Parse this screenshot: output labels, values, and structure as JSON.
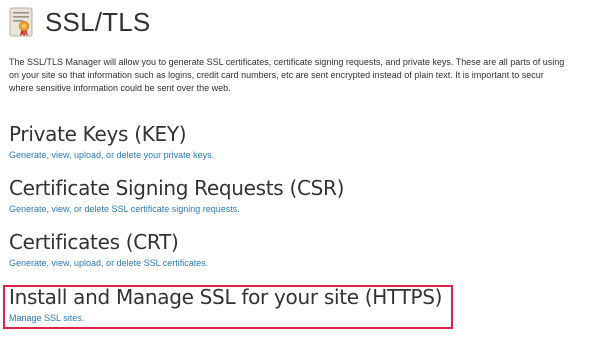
{
  "header": {
    "title": "SSL/TLS",
    "icon": "certificate-icon"
  },
  "intro": {
    "line1": "The SSL/TLS Manager will allow you to generate SSL certificates, certificate signing requests, and private keys. These are all parts of using",
    "line2": "on your site so that information such as logins, credit card numbers, etc are sent encrypted instead of plain text. It is important to secur",
    "line3": "where sensitive information could be sent over the web."
  },
  "sections": [
    {
      "title": "Private Keys (KEY)",
      "link": "Generate, view, upload, or delete your private keys."
    },
    {
      "title": "Certificate Signing Requests (CSR)",
      "link": "Generate, view, or delete SSL certificate signing requests."
    },
    {
      "title": "Certificates (CRT)",
      "link": "Generate, view, upload, or delete SSL certificates."
    },
    {
      "title": "Install and Manage SSL for your site (HTTPS)",
      "link": "Manage SSL sites."
    }
  ],
  "colors": {
    "link": "#2f7ab9",
    "highlight": "#d6264b",
    "text": "#333333"
  }
}
